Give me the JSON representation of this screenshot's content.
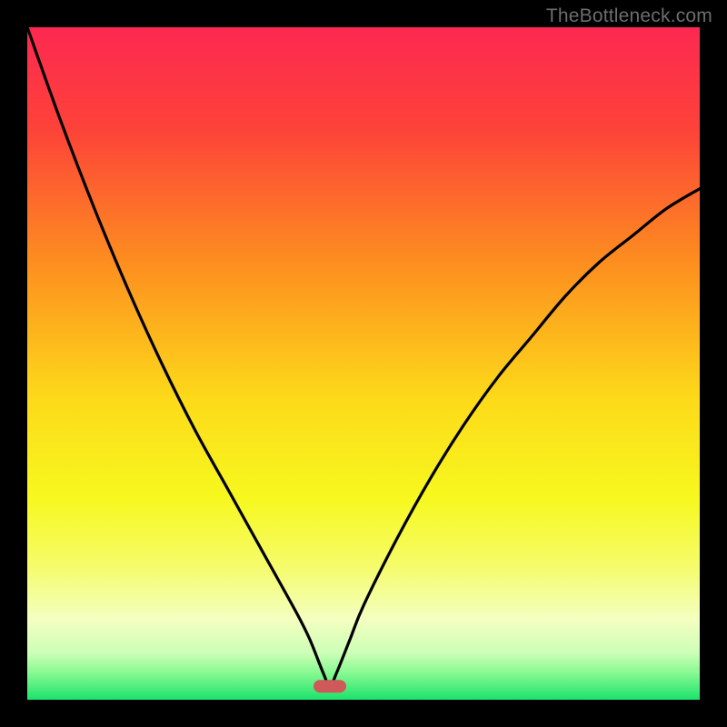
{
  "watermark": "TheBottleneck.com",
  "chart_data": {
    "type": "line",
    "title": "",
    "xlabel": "",
    "ylabel": "",
    "xlim": [
      0,
      100
    ],
    "ylim": [
      0,
      100
    ],
    "series": [
      {
        "name": "curve",
        "x": [
          0,
          5,
          10,
          15,
          20,
          25,
          30,
          35,
          40,
          42,
          44,
          45,
          46,
          48,
          50,
          55,
          60,
          65,
          70,
          75,
          80,
          85,
          90,
          95,
          100
        ],
        "y": [
          100,
          86,
          73,
          61,
          50,
          40,
          31,
          22,
          13,
          9,
          4,
          2,
          4,
          9,
          14,
          24,
          33,
          41,
          48,
          54,
          60,
          65,
          69,
          73,
          76
        ]
      }
    ],
    "marker": {
      "x": 45,
      "y": 2,
      "color": "#cf5858"
    },
    "gradient_stops": [
      {
        "offset": 0.0,
        "color": "#fd2851"
      },
      {
        "offset": 0.15,
        "color": "#fd4239"
      },
      {
        "offset": 0.35,
        "color": "#fd8e1f"
      },
      {
        "offset": 0.55,
        "color": "#fdd91a"
      },
      {
        "offset": 0.7,
        "color": "#f7f81e"
      },
      {
        "offset": 0.8,
        "color": "#f5fc69"
      },
      {
        "offset": 0.88,
        "color": "#f4ffc0"
      },
      {
        "offset": 0.93,
        "color": "#cdffb8"
      },
      {
        "offset": 0.96,
        "color": "#88f991"
      },
      {
        "offset": 1.0,
        "color": "#1be36d"
      }
    ]
  }
}
